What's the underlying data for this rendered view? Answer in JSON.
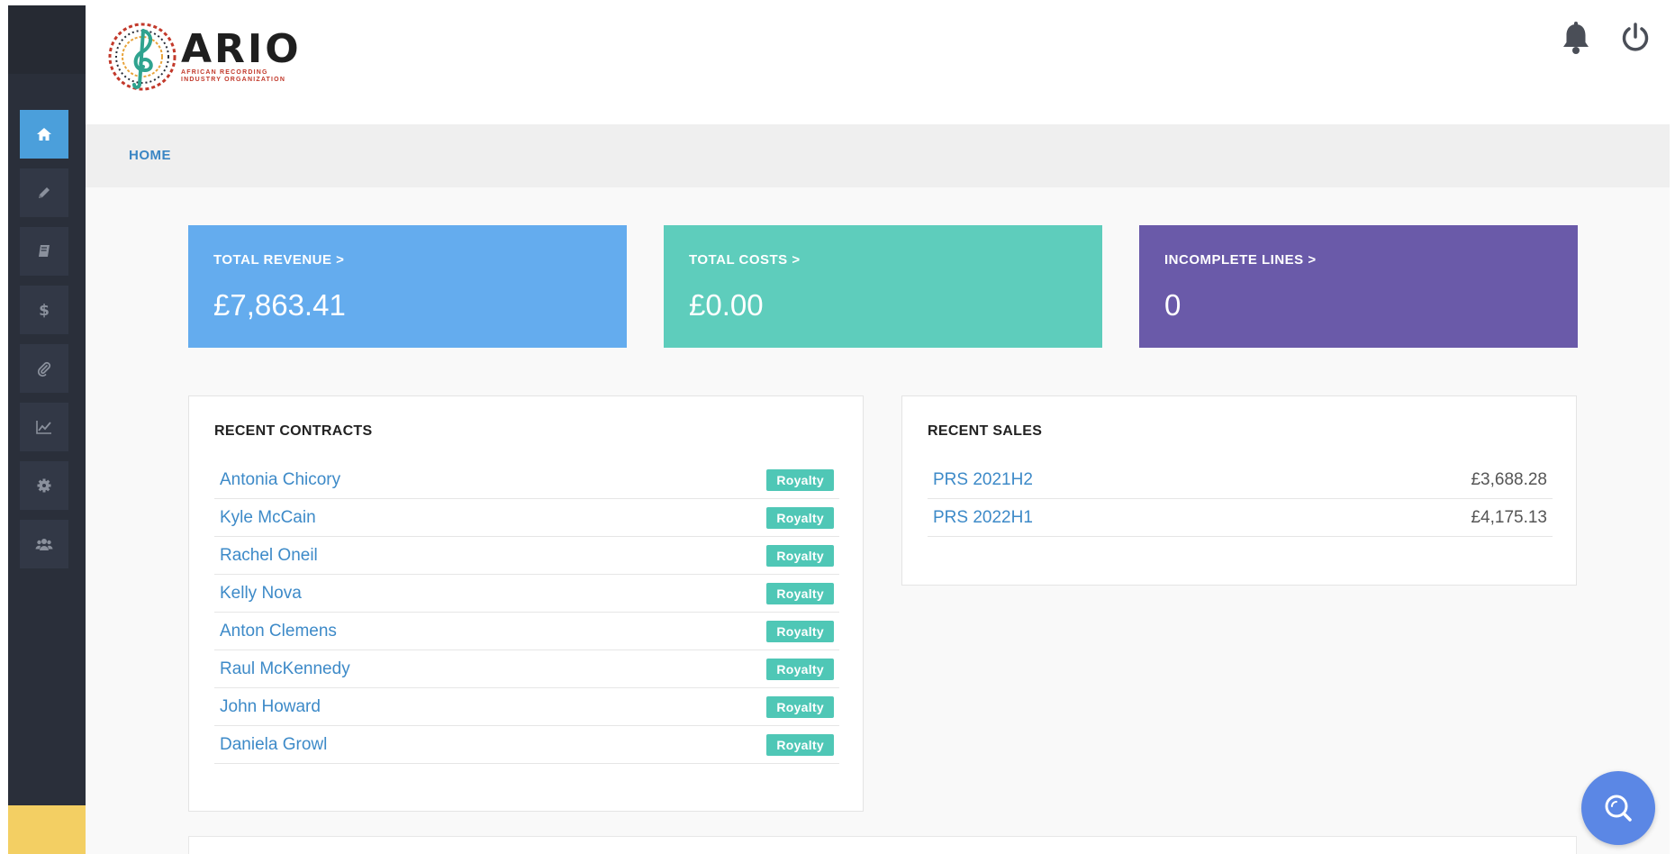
{
  "header": {
    "logo": {
      "word": "ARIO",
      "subtitle": "African Recording Industry Organization"
    }
  },
  "sidebar": {
    "items": [
      {
        "icon": "home-icon",
        "active": true
      },
      {
        "icon": "pencil-icon",
        "active": false
      },
      {
        "icon": "book-icon",
        "active": false
      },
      {
        "icon": "dollar-icon",
        "active": false
      },
      {
        "icon": "paperclip-icon",
        "active": false
      },
      {
        "icon": "line-chart-icon",
        "active": false
      },
      {
        "icon": "gear-icon",
        "active": false
      },
      {
        "icon": "users-icon",
        "active": false
      }
    ]
  },
  "breadcrumb": {
    "label": "HOME"
  },
  "stats": {
    "revenue": {
      "label": "TOTAL REVENUE >",
      "value": "£7,863.41",
      "color": "#64acee"
    },
    "costs": {
      "label": "TOTAL COSTS >",
      "value": "£0.00",
      "color": "#5ecdbc"
    },
    "incomplete": {
      "label": "INCOMPLETE LINES >",
      "value": "0",
      "color": "#6a5aa9"
    }
  },
  "recent_contracts": {
    "title": "RECENT CONTRACTS",
    "rows": [
      {
        "name": "Antonia Chicory",
        "type": "Royalty"
      },
      {
        "name": "Kyle McCain",
        "type": "Royalty"
      },
      {
        "name": "Rachel Oneil",
        "type": "Royalty"
      },
      {
        "name": "Kelly Nova",
        "type": "Royalty"
      },
      {
        "name": "Anton Clemens",
        "type": "Royalty"
      },
      {
        "name": "Raul McKennedy",
        "type": "Royalty"
      },
      {
        "name": "John Howard",
        "type": "Royalty"
      },
      {
        "name": "Daniela Growl",
        "type": "Royalty"
      }
    ]
  },
  "recent_sales": {
    "title": "RECENT SALES",
    "rows": [
      {
        "name": "PRS 2021H2",
        "amount": "£3,688.28"
      },
      {
        "name": "PRS 2022H1",
        "amount": "£4,175.13"
      }
    ]
  },
  "colors": {
    "accent": "#4b9fdb",
    "sidebar": "#2a2f3a",
    "badge": "#4fc7b6",
    "link": "#3d8ac8"
  }
}
